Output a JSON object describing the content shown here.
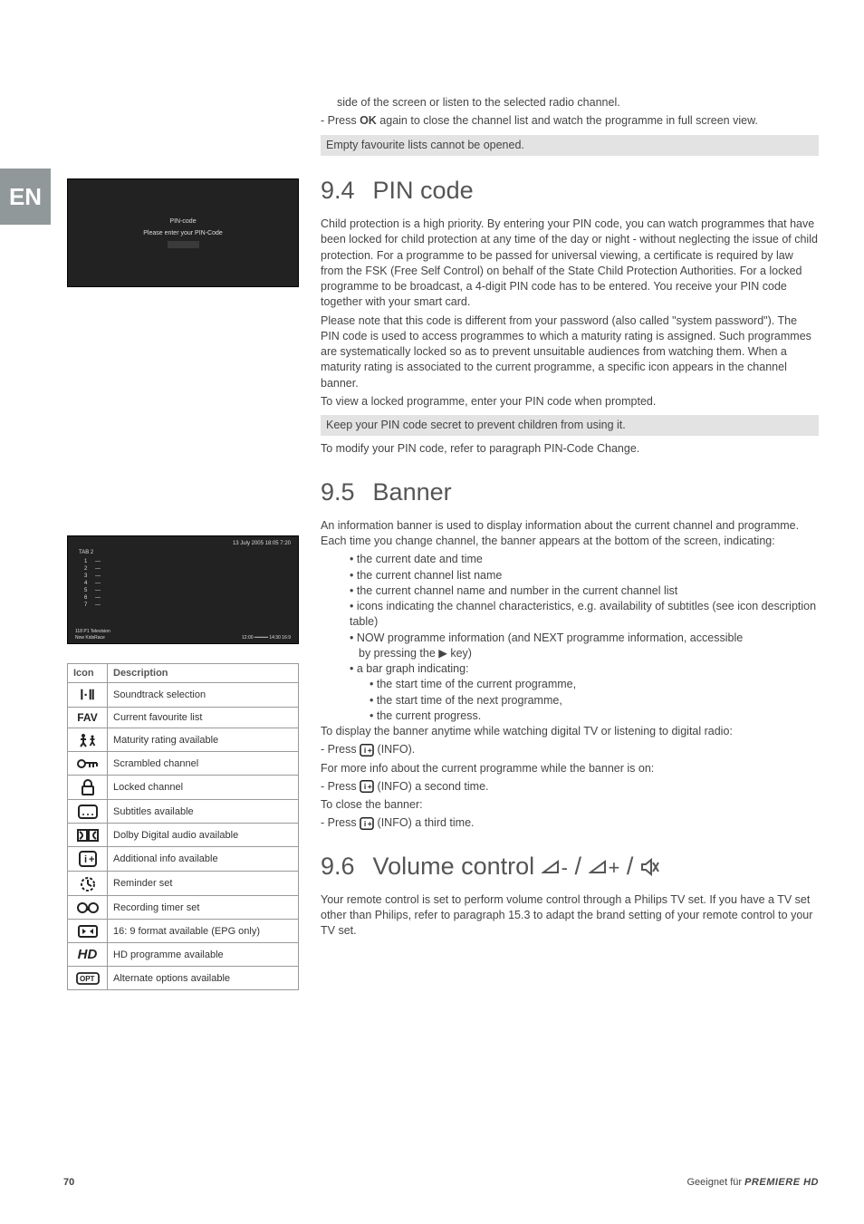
{
  "lang_tab": "EN",
  "intro": {
    "line1": "side of the screen or listen to the selected radio channel.",
    "line2_prefix": "- Press ",
    "line2_bold": "OK",
    "line2_suffix": " again to close the channel list and watch the programme in full screen view.",
    "note": "Empty favourite lists cannot be opened."
  },
  "sec94": {
    "num": "9.4",
    "title": "PIN code",
    "p1": "Child protection is a high priority. By entering your PIN code, you can watch programmes that have been locked for child protection at any time of the day or night - without neglecting the issue of child protection. For a programme to be passed for universal viewing, a certificate is required by law from the FSK (Free Self Control) on behalf of the State Child Protection Authorities. For a locked programme to be broadcast, a 4-digit PIN code has to be entered. You receive your PIN code together with your smart card.",
    "p2": "Please note that this code is different from your password (also called \"system password\"). The PIN code is used to access programmes to which a maturity rating is assigned. Such programmes are systematically locked so as to prevent unsuitable audiences from watching them. When a maturity rating is associated to the current programme, a specific icon appears in the channel banner.",
    "p3": "To view a locked programme, enter your PIN code when prompted.",
    "note": "Keep your PIN code secret to prevent children from using it.",
    "p4": "To modify your PIN code, refer to paragraph PIN-Code Change."
  },
  "sec95": {
    "num": "9.5",
    "title": "Banner",
    "p1": "An information banner is used to display information about the current channel and programme. Each time you change channel, the banner appears at the bottom of the screen, indicating:",
    "b1": "the current date and time",
    "b2": "the current channel list name",
    "b3": "the current channel name and number in the current channel list",
    "b4": "icons indicating the channel characteristics, e.g. availability of subtitles (see icon description table)",
    "b5a": "NOW programme information (and NEXT programme information, accessible",
    "b5b": "by pressing the ",
    "b5c": " key)",
    "b6": "a bar graph indicating:",
    "sb1": "the start time of the current programme,",
    "sb2": "the start time of the next programme,",
    "sb3": "the current progress.",
    "p2": "To display the banner anytime while watching digital TV or listening to digital radio:",
    "p3": "- Press ",
    "p3b": " (INFO).",
    "p4": "For more info about the current programme while the banner is on:",
    "p5": "- Press ",
    "p5b": " (INFO) a second time.",
    "p6": "To close the banner:",
    "p7": "- Press ",
    "p7b": " (INFO) a third time."
  },
  "sec96": {
    "num": "9.6",
    "title": "Volume control ",
    "p1": "Your remote control is set to perform volume control through a Philips TV set. If you have a TV set other than Philips, refer to paragraph 15.3 to adapt the brand setting of your remote control to your TV set."
  },
  "icon_table": {
    "h1": "Icon",
    "h2": "Description",
    "rows": [
      {
        "icon": "I·II",
        "desc": "Soundtrack selection"
      },
      {
        "icon": "FAV",
        "desc": "Current favourite list"
      },
      {
        "icon": "maturity",
        "desc": "Maturity rating available"
      },
      {
        "icon": "scrambled",
        "desc": "Scrambled channel"
      },
      {
        "icon": "locked",
        "desc": "Locked channel"
      },
      {
        "icon": "subtitles",
        "desc": "Subtitles available"
      },
      {
        "icon": "dolby",
        "desc": "Dolby Digital audio available"
      },
      {
        "icon": "info",
        "desc": "Additional info available"
      },
      {
        "icon": "reminder",
        "desc": "Reminder set"
      },
      {
        "icon": "recording",
        "desc": "Recording timer set"
      },
      {
        "icon": "format",
        "desc": "16: 9 format available (EPG only)"
      },
      {
        "icon": "HD",
        "desc": "HD programme available"
      },
      {
        "icon": "OPT",
        "desc": "Alternate options available"
      }
    ]
  },
  "pin_img": {
    "t1": "PIN-code",
    "t2": "Please enter your PIN-Code"
  },
  "banner_img": {
    "date": "13 July 2005   18:05   7:20",
    "tab": "TAB 2",
    "bot1": "118   P1 Television",
    "bot2": "Now    KidsRace",
    "bot3": "12:00 ━━━━━ 14:30  16:9"
  },
  "footer": {
    "page": "70",
    "text": "Geeignet für ",
    "brand": "PREMIERE HD"
  }
}
